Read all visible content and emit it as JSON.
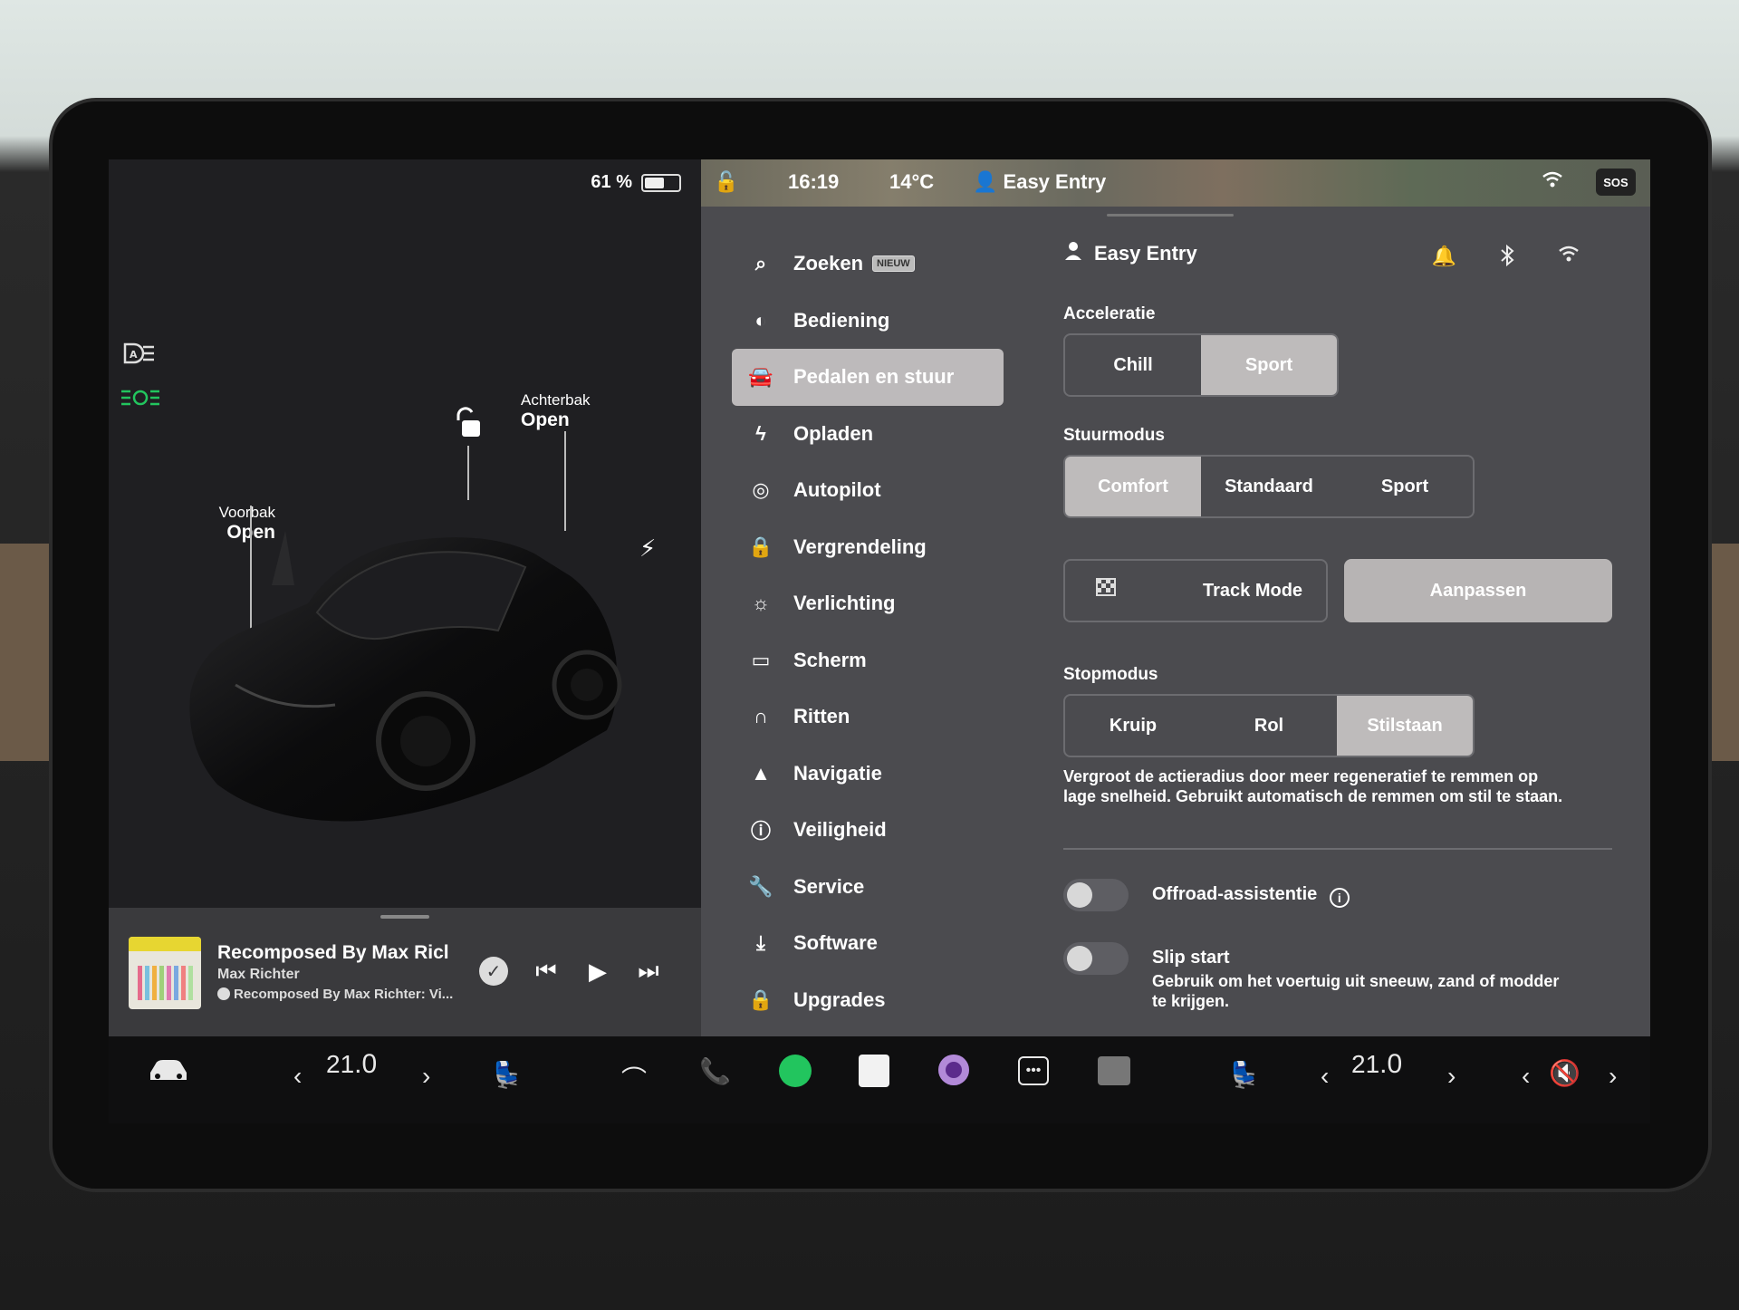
{
  "status": {
    "battery_percent": "61 %",
    "battery_level": 0.61,
    "time": "16:19",
    "temperature": "14°C",
    "profile": "Easy Entry",
    "sos": "SOS"
  },
  "car": {
    "frunk_label": "Voorbak",
    "frunk_state": "Open",
    "trunk_label": "Achterbak",
    "trunk_state": "Open"
  },
  "media": {
    "title": "Recomposed By Max Ricl",
    "artist": "Max Richter",
    "source": "Recomposed By Max Richter: Vi..."
  },
  "nav": {
    "items": [
      {
        "label": "Zoeken",
        "icon": "search-icon",
        "badge": "NIEUW"
      },
      {
        "label": "Bediening",
        "icon": "toggle-icon"
      },
      {
        "label": "Pedalen en stuur",
        "icon": "car-icon",
        "active": true
      },
      {
        "label": "Opladen",
        "icon": "bolt-icon"
      },
      {
        "label": "Autopilot",
        "icon": "steering-wheel-icon"
      },
      {
        "label": "Vergrendeling",
        "icon": "lock-icon"
      },
      {
        "label": "Verlichting",
        "icon": "sun-icon"
      },
      {
        "label": "Scherm",
        "icon": "display-icon"
      },
      {
        "label": "Ritten",
        "icon": "trips-icon"
      },
      {
        "label": "Navigatie",
        "icon": "navigation-icon"
      },
      {
        "label": "Veiligheid",
        "icon": "safety-icon"
      },
      {
        "label": "Service",
        "icon": "wrench-icon"
      },
      {
        "label": "Software",
        "icon": "download-icon"
      },
      {
        "label": "Upgrades",
        "icon": "bag-icon"
      }
    ]
  },
  "content": {
    "profile": "Easy Entry",
    "acceleratie": {
      "label": "Acceleratie",
      "options": [
        "Chill",
        "Sport"
      ],
      "selected": "Sport"
    },
    "stuurmodus": {
      "label": "Stuurmodus",
      "options": [
        "Comfort",
        "Standaard",
        "Sport"
      ],
      "selected": "Comfort"
    },
    "track_mode": "Track Mode",
    "aanpassen": "Aanpassen",
    "stopmodus": {
      "label": "Stopmodus",
      "options": [
        "Kruip",
        "Rol",
        "Stilstaan"
      ],
      "selected": "Stilstaan",
      "description_line1": "Vergroot de actieradius door meer regeneratief te remmen op",
      "description_line2": "lage snelheid. Gebruikt automatisch de remmen om stil te staan."
    },
    "offroad": "Offroad-assistentie",
    "slip_start": "Slip start",
    "slip_desc_line1": "Gebruik om het voertuig uit sneeuw, zand of modder",
    "slip_desc_line2": "te krijgen."
  },
  "dock": {
    "temp_left_main": "21",
    "temp_left_dec": ".0",
    "temp_right_main": "21",
    "temp_right_dec": ".0"
  },
  "colors": {
    "accent_green": "#22c55e",
    "selected_segment": "#bebbbb",
    "panel": "#4b4b4f"
  }
}
